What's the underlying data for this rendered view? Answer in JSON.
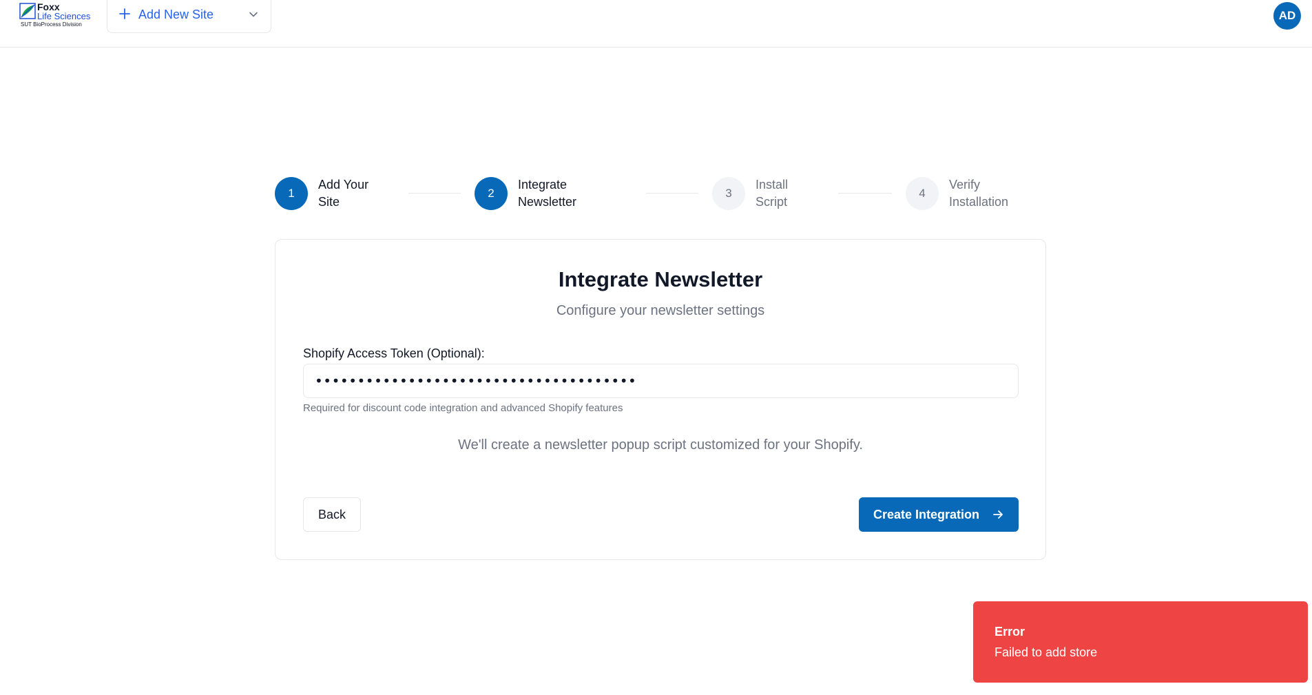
{
  "header": {
    "logo": {
      "title": "Foxx",
      "subtitle": "Life Sciences",
      "division": "SUT BioProcess Division"
    },
    "site_selector": {
      "label": "Add New Site",
      "icon": "plus-icon",
      "dropdown_icon": "chevron-down-icon"
    },
    "user": {
      "initials": "AD"
    }
  },
  "stepper": {
    "steps": [
      {
        "number": "1",
        "line1": "Add Your",
        "line2": "Site",
        "state": "complete"
      },
      {
        "number": "2",
        "line1": "Integrate",
        "line2": "Newsletter",
        "state": "active"
      },
      {
        "number": "3",
        "line1": "Install",
        "line2": "Script",
        "state": "upcoming"
      },
      {
        "number": "4",
        "line1": "Verify",
        "line2": "Installation",
        "state": "upcoming"
      }
    ]
  },
  "card": {
    "title": "Integrate Newsletter",
    "subtitle": "Configure your newsletter settings",
    "token_field": {
      "label": "Shopify Access Token (Optional):",
      "value": "••••••••••••••••••••••••••••••••••••••",
      "help": "Required for discount code integration and advanced Shopify features"
    },
    "note": "We'll create a newsletter popup script customized for your Shopify.",
    "back_label": "Back",
    "create_label": "Create Integration",
    "create_icon": "arrow-right-icon"
  },
  "toast": {
    "title": "Error",
    "message": "Failed to add store"
  },
  "colors": {
    "primary": "#0769b8",
    "link": "#2563eb",
    "muted": "#6b7280",
    "border": "#e5e7eb",
    "error": "#ef4444"
  }
}
